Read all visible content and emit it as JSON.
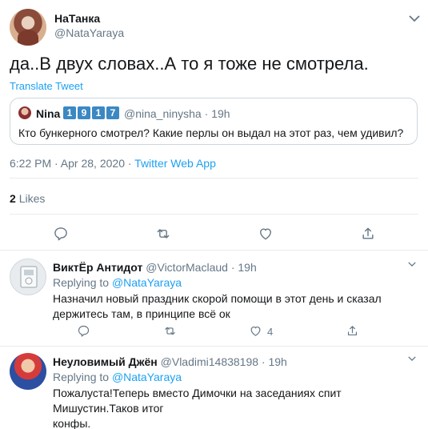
{
  "main_tweet": {
    "name": "НаТанка",
    "handle": "@NataYaraya",
    "text": "да..В двух словах..А то я тоже не смотрела.",
    "translate_label": "Translate Tweet",
    "timestamp": "6:22 PM · Apr 28, 2020 · ",
    "source": "Twitter Web App",
    "likes_count": "2",
    "likes_label": "Likes"
  },
  "quote": {
    "name": "Nina",
    "badges": [
      "1",
      "9",
      "1",
      "7"
    ],
    "handle_time": "@nina_ninysha · 19h",
    "text": "Кто бункерного смотрел? Какие перлы он выдал на этот раз, чем удивил?"
  },
  "replies": [
    {
      "name": "ВиктЁр Антидот",
      "handle_time": "@VictorMaclaud · 19h",
      "replying_prefix": "Replying to ",
      "replying_to": "@NataYaraya",
      "text": "Назначил новый праздник скорой помощи в этот день и сказал держитесь там, в принципе всё ок",
      "like_count": "4"
    },
    {
      "name": "Неуловимый Джён",
      "handle_time": "@Vladimi14838198 · 19h",
      "replying_prefix": "Replying to ",
      "replying_to": "@NataYaraya",
      "text": "Пожалуста!Теперь вместо Димочки на заседаниях спит Мишустин.Таков итог\nконфы."
    }
  ],
  "colors": {
    "accent": "#1da1f2",
    "muted": "#657786",
    "border": "#e6ecf0",
    "badge": "#3b88c3"
  },
  "icons": [
    "chevron-down-icon",
    "reply-icon",
    "retweet-icon",
    "like-icon",
    "share-icon"
  ]
}
